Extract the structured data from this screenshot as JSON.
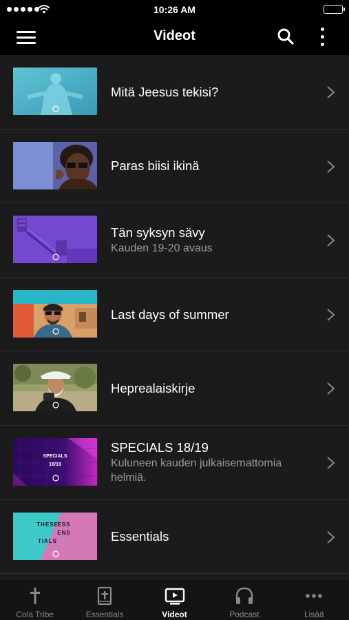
{
  "status_bar": {
    "time": "10:26 AM"
  },
  "nav": {
    "title": "Videot"
  },
  "videos": [
    {
      "title": "Mitä Jeesus tekisi?",
      "subtitle": ""
    },
    {
      "title": "Paras biisi ikinä",
      "subtitle": ""
    },
    {
      "title": "Tän syksyn sävy",
      "subtitle": "Kauden 19-20 avaus"
    },
    {
      "title": "Last days of summer",
      "subtitle": ""
    },
    {
      "title": "Heprealaiskirje",
      "subtitle": ""
    },
    {
      "title": "SPECIALS 18/19",
      "subtitle": "Kuluneen kauden julkaisemattomia helmiä."
    },
    {
      "title": "Essentials",
      "subtitle": ""
    }
  ],
  "thumbs": {
    "specials": "SPECIALS",
    "specials_year": "18/19",
    "essentials_left": "THESE",
    "essentials_left2": "TIALS",
    "essentials_right": "ESS",
    "essentials_right2": "ENS"
  },
  "tabs": [
    {
      "label": "Cola Tribe",
      "icon": "cross-icon"
    },
    {
      "label": "Essentials",
      "icon": "bible-icon"
    },
    {
      "label": "Videot",
      "icon": "tv-play-icon",
      "active": true
    },
    {
      "label": "Podcast",
      "icon": "headphones-icon"
    },
    {
      "label": "Lisää",
      "icon": "more-dots-icon"
    }
  ],
  "colors": {
    "background": "#1b1b1b",
    "bar": "#000000",
    "tab_bar": "#141414",
    "subtitle": "#9a9a9a"
  }
}
